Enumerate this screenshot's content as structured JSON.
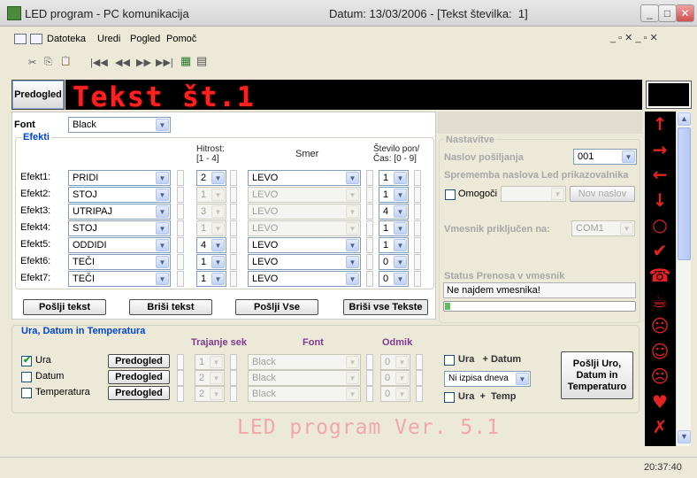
{
  "window": {
    "title": "LED program - PC komunikacija",
    "date_text": "Datum: 13/03/2006 - [Tekst številka:  1]",
    "btn_min": "_",
    "btn_max": "□",
    "btn_close": "✕"
  },
  "menu": {
    "items": [
      "Datoteka",
      "Uredi",
      "Pogled",
      "Pomoč"
    ],
    "mdi_controls": "_ ▫ ✕   _ ▫ ✕"
  },
  "toolbar": {
    "icons": [
      "cut-icon",
      "copy-icon",
      "paste-icon",
      "first-icon",
      "prev-icon",
      "next-icon",
      "last-icon",
      "grid-icon",
      "list-icon"
    ],
    "glyphs": [
      "✂",
      "⎘",
      "📋",
      "|◀◀",
      "◀◀",
      "▶▶",
      "▶▶|",
      "▦",
      "▤"
    ]
  },
  "led": {
    "preview_label": "Predogled",
    "text": "Tekst št.1"
  },
  "font": {
    "label": "Font",
    "value": "Black"
  },
  "efekti": {
    "title": "Efekti",
    "col_speed": "Hitrost:",
    "col_speed_range": "[1 - 4]",
    "col_dir": "Smer",
    "col_rep": "Število pon/",
    "col_rep_range": "Čas:  [0 - 9]",
    "rows": [
      {
        "label": "Efekt1:",
        "effect": "PRIDI",
        "speed": "2",
        "dir": "LEVO",
        "rep": "1",
        "enabled": true
      },
      {
        "label": "Efekt2:",
        "effect": "STOJ",
        "speed": "1",
        "dir": "LEVO",
        "rep": "1",
        "enabled": false
      },
      {
        "label": "Efekt3:",
        "effect": "UTRIPAJ",
        "speed": "3",
        "dir": "LEVO",
        "rep": "4",
        "enabled": false
      },
      {
        "label": "Efekt4:",
        "effect": "STOJ",
        "speed": "1",
        "dir": "LEVO",
        "rep": "1",
        "enabled": false
      },
      {
        "label": "Efekt5:",
        "effect": "ODDIDI",
        "speed": "4",
        "dir": "LEVO",
        "rep": "1",
        "enabled": true
      },
      {
        "label": "Efekt6:",
        "effect": "TEČI",
        "speed": "1",
        "dir": "LEVO",
        "rep": "0",
        "enabled": true
      },
      {
        "label": "Efekt7:",
        "effect": "TEČI",
        "speed": "1",
        "dir": "LEVO",
        "rep": "0",
        "enabled": true
      }
    ],
    "btn_send": "Pošlji tekst",
    "btn_delete": "Briši tekst",
    "btn_send_all": "Pošlji Vse",
    "btn_delete_all": "Briši vse Tekste"
  },
  "nastavitve": {
    "title": "Nastavitve",
    "address_label": "Naslov pošiljanja",
    "address_value": "001",
    "change_label": "Sprememba naslova Led prikazovalnika",
    "enable_label": "Omogoči",
    "new_address_btn": "Nov naslov",
    "port_label": "Vmesnik priključen na:",
    "port_value": "COM1",
    "status_label": "Status Prenosa v vmesnik",
    "status_value": "Ne najdem vmesnika!"
  },
  "ura": {
    "title": "Ura, Datum in Temperatura",
    "col_duration": "Trajanje sek",
    "col_font": "Font",
    "col_offset": "Odmik",
    "rows": [
      {
        "label": "Ura",
        "checked": true,
        "btn": "Predogled",
        "dur": "1",
        "font": "Black",
        "off": "0"
      },
      {
        "label": "Datum",
        "checked": false,
        "btn": "Predogled",
        "dur": "2",
        "font": "Black",
        "off": "0"
      },
      {
        "label": "Temperatura",
        "checked": false,
        "btn": "Predogled",
        "dur": "2",
        "font": "Black",
        "off": "0"
      }
    ],
    "ura_datum_label": "Ura   + Datum",
    "no_date_value": "Ni izpisa dneva",
    "ura_temp_label": "Ura  +  Temp",
    "send_btn": "Pošlji Uro, Datum in Temperaturo"
  },
  "version_text": "LED program Ver. 5.1",
  "led_symbols": [
    "↑",
    "→",
    "←",
    "↓",
    "○",
    "✔",
    "☎",
    "☕",
    "☹",
    "☺",
    "☹",
    "♥",
    "✗"
  ],
  "status": {
    "clock": "20:37:40"
  }
}
